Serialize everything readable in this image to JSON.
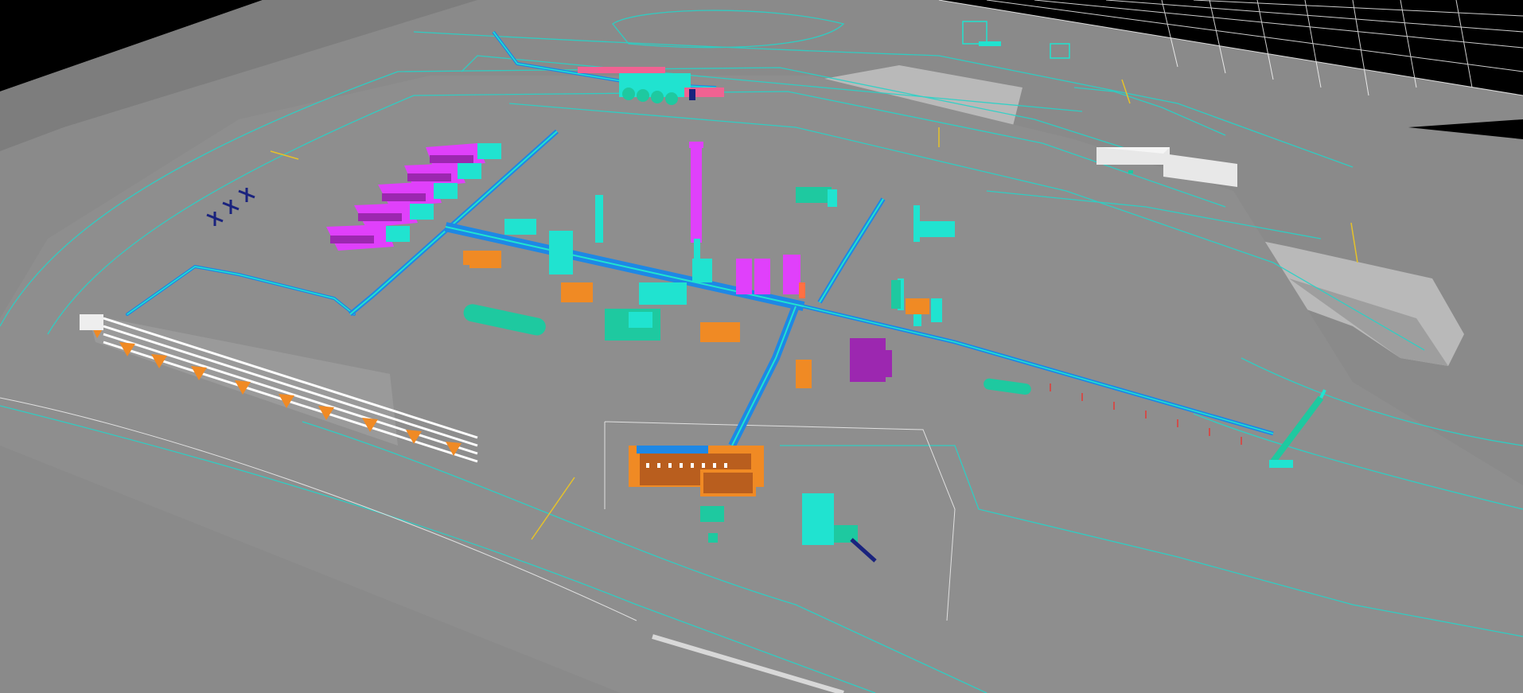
{
  "scene": {
    "description_visible_text": "",
    "view": "3d-plant-model-perspective"
  },
  "palette": {
    "background": "#000000",
    "ground": "#8a8a8a",
    "ground_dark": "#7a7a7a",
    "ground_light": "#b9b9b9",
    "contour": "#27d3c8",
    "pipe_blue": "#1e88e5",
    "pipe_cyan": "#20e3d0",
    "magenta": "#e040fb",
    "purple": "#9c27b0",
    "orange": "#f08a24",
    "teal": "#1ec9a0",
    "yellow": "#e6c229",
    "building_white": "#e8e8e8",
    "dark_blue": "#1a237e",
    "white": "#ffffff"
  },
  "elements": {
    "pipe_racks": [
      "main-east-west-rack",
      "north-south-rack",
      "east-flare-line",
      "west-loop-line",
      "north-feed-line"
    ],
    "equipment_groups": [
      "compressor-trains",
      "fractionation-column",
      "tank-farm-jetty",
      "utility-block",
      "flare-stack"
    ],
    "buildings": [
      "control-building"
    ]
  }
}
